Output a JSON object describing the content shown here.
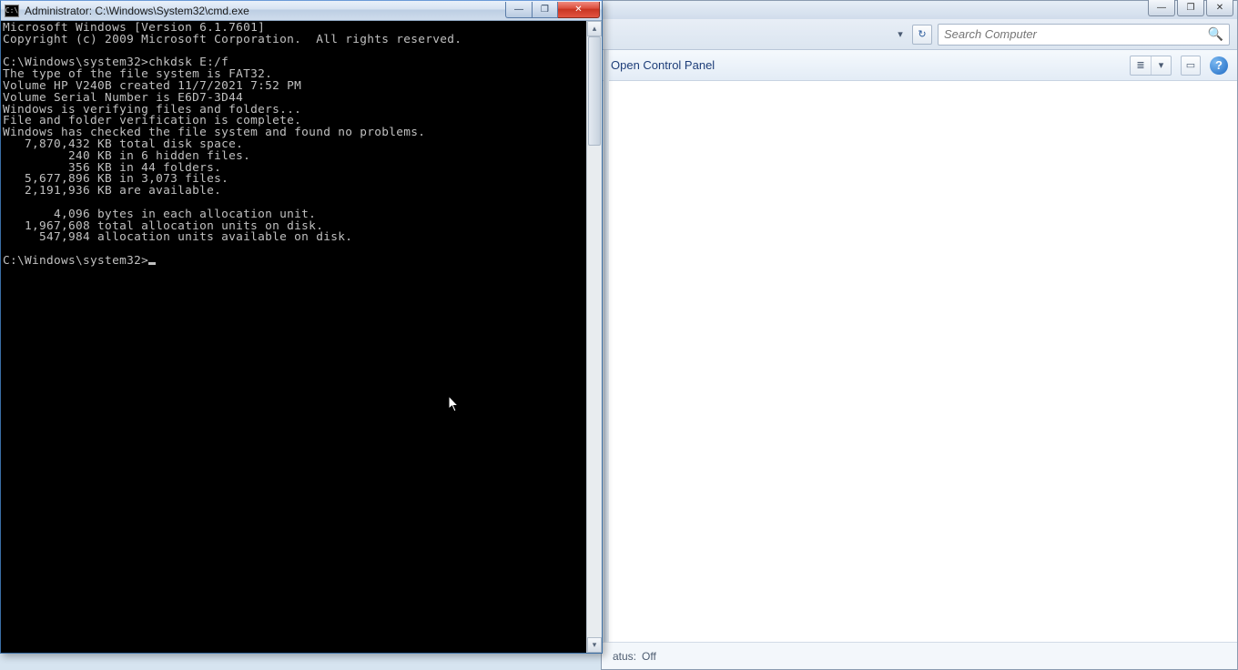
{
  "cmd": {
    "title": "Administrator: C:\\Windows\\System32\\cmd.exe",
    "icon_label": "C:\\",
    "lines": [
      "Microsoft Windows [Version 6.1.7601]",
      "Copyright (c) 2009 Microsoft Corporation.  All rights reserved.",
      "",
      "C:\\Windows\\system32>chkdsk E:/f",
      "The type of the file system is FAT32.",
      "Volume HP V240B created 11/7/2021 7:52 PM",
      "Volume Serial Number is E6D7-3D44",
      "Windows is verifying files and folders...",
      "File and folder verification is complete.",
      "Windows has checked the file system and found no problems.",
      "   7,870,432 KB total disk space.",
      "         240 KB in 6 hidden files.",
      "         356 KB in 44 folders.",
      "   5,677,896 KB in 3,073 files.",
      "   2,191,936 KB are available.",
      "",
      "       4,096 bytes in each allocation unit.",
      "   1,967,608 total allocation units on disk.",
      "     547,984 allocation units available on disk.",
      "",
      "C:\\Windows\\system32>"
    ]
  },
  "explorer": {
    "search_placeholder": "Search Computer",
    "toolbar": {
      "open_cp": "Open Control Panel"
    },
    "status": {
      "label": "atus:",
      "value": "Off"
    }
  },
  "glyphs": {
    "minimize": "—",
    "maximize": "❐",
    "close": "✕",
    "chevron_down": "▾",
    "chevron_up": "▴",
    "refresh": "↻",
    "search": "🔍",
    "help": "?",
    "view_icon": "≣",
    "pane": "▭"
  }
}
